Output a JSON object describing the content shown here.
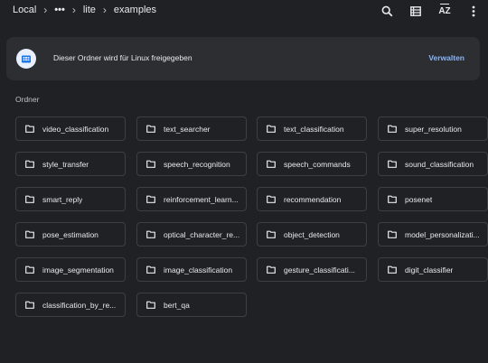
{
  "breadcrumb": {
    "items": [
      "Local",
      "•••",
      "lite",
      "examples"
    ]
  },
  "toolbar": {
    "search_icon": "search-icon",
    "view_icon": "list-view-icon",
    "sort_label": "AZ",
    "more_icon": "more-vertical-icon"
  },
  "banner": {
    "icon": "linux-share-icon",
    "text": "Dieser Ordner wird für Linux freigegeben",
    "action": "Verwalten",
    "accent_color": "#8ab4f8"
  },
  "section": {
    "label": "Ordner"
  },
  "folders": [
    "video_classification",
    "text_searcher",
    "text_classification",
    "super_resolution",
    "style_transfer",
    "speech_recognition",
    "speech_commands",
    "sound_classification",
    "smart_reply",
    "reinforcement_learn...",
    "recommendation",
    "posenet",
    "pose_estimation",
    "optical_character_re...",
    "object_detection",
    "model_personalizati...",
    "image_segmentation",
    "image_classification",
    "gesture_classificati...",
    "digit_classifier",
    "classification_by_re...",
    "bert_qa"
  ]
}
